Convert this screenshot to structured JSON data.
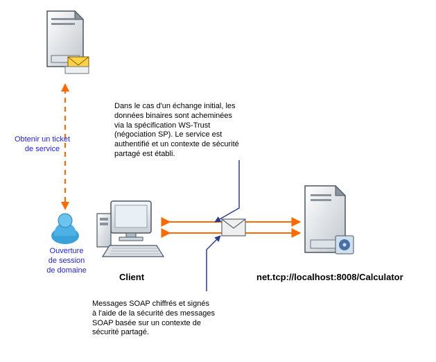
{
  "labels": {
    "ticket": "Obtenir un ticket\nde service",
    "session": "Ouverture\nde session\nde domaine",
    "client": "Client",
    "service_url": "net.tcp://localhost:8008/Calculator",
    "desc_top": "Dans le cas d'un échange initial, les\ndonnées binaires sont acheminées\nvia la spécification WS-Trust\n(négociation SP). Le service est\nauthentifié et un contexte de sécurité\npartagé est établi.",
    "desc_bottom": "Messages SOAP chiffrés et signés\nà l'aide de la sécurité des messages\nSOAP basée sur un contexte de\nsécurité partagé."
  }
}
